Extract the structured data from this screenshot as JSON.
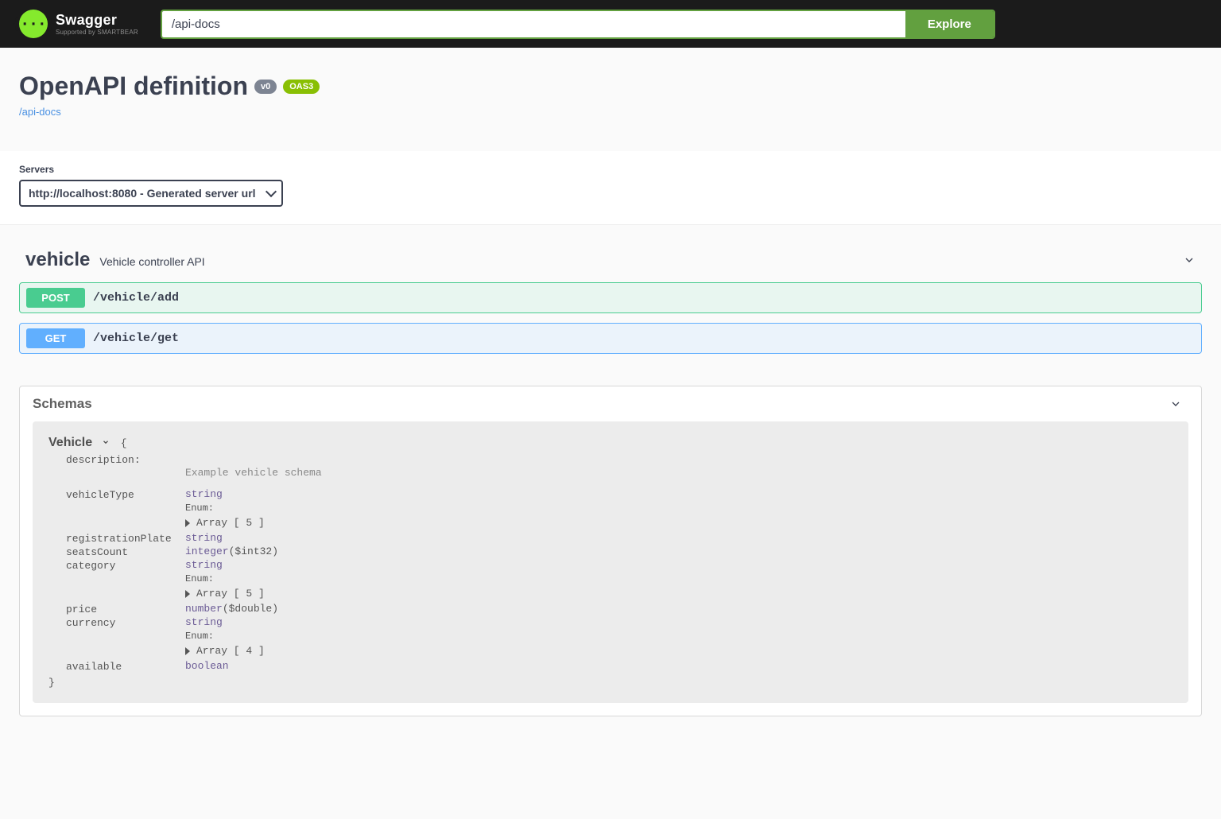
{
  "topbar": {
    "logo_glyph": "{···}",
    "logo_name": "Swagger",
    "logo_sub": "Supported by SMARTBEAR",
    "search_value": "/api-docs",
    "explore_label": "Explore"
  },
  "info": {
    "title": "OpenAPI definition",
    "version_badge": "v0",
    "oas_badge": "OAS3",
    "link": "/api-docs"
  },
  "servers": {
    "label": "Servers",
    "selected": "http://localhost:8080 - Generated server url"
  },
  "tag": {
    "name": "vehicle",
    "description": "Vehicle controller API"
  },
  "operations": [
    {
      "method": "POST",
      "path": "/vehicle/add",
      "cls": "op-post"
    },
    {
      "method": "GET",
      "path": "/vehicle/get",
      "cls": "op-get"
    }
  ],
  "schemas": {
    "title": "Schemas",
    "model_name": "Vehicle",
    "description_key": "description:",
    "description_value": "Example vehicle schema",
    "properties": [
      {
        "name": "vehicleType",
        "type": "string",
        "enum_label": "Enum:",
        "enum_array": "Array [ 5 ]"
      },
      {
        "name": "registrationPlate",
        "type": "string"
      },
      {
        "name": "seatsCount",
        "type": "integer",
        "format": "($int32)"
      },
      {
        "name": "category",
        "type": "string",
        "enum_label": "Enum:",
        "enum_array": "Array [ 5 ]"
      },
      {
        "name": "price",
        "type": "number",
        "format": "($double)"
      },
      {
        "name": "currency",
        "type": "string",
        "enum_label": "Enum:",
        "enum_array": "Array [ 4 ]"
      },
      {
        "name": "available",
        "type": "boolean"
      }
    ]
  }
}
